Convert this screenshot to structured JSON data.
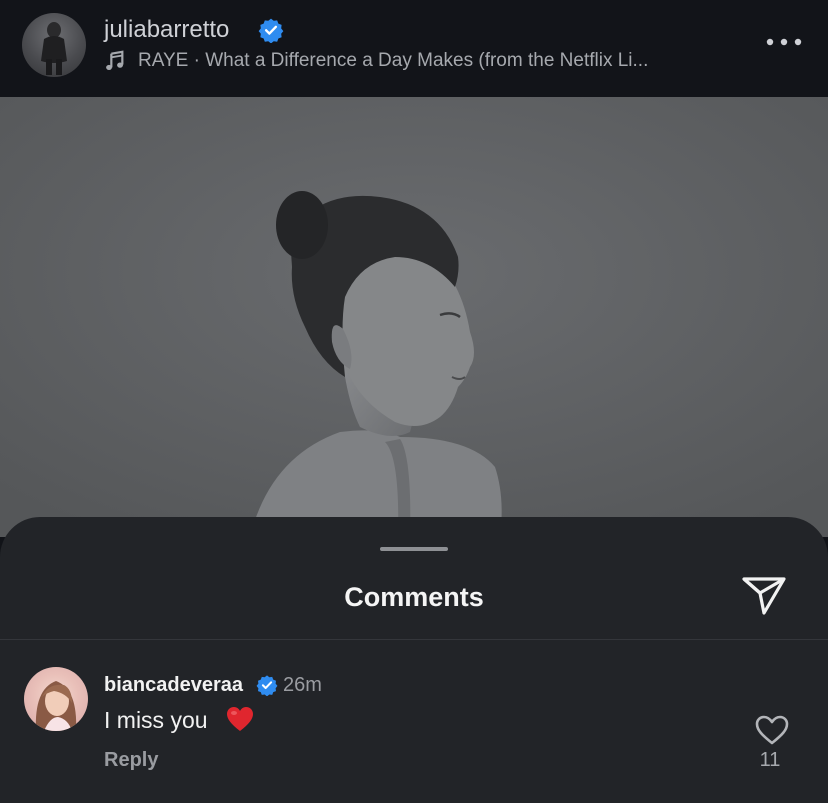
{
  "post": {
    "username": "juliabarretto",
    "verified": true,
    "song": "RAYE · What a Difference a Day Makes (from the Netflix Li..."
  },
  "icons": {
    "more": "more-horizontal-icon",
    "music": "music-note-icon",
    "verified": "verified-badge-icon",
    "send": "send-icon",
    "like": "heart-outline-icon"
  },
  "colors": {
    "verified_blue": "#2f8cf0",
    "sheet_bg": "#222428",
    "photo_bg": "#5b5d60"
  },
  "comments_sheet": {
    "title": "Comments",
    "comments": [
      {
        "username": "biancadeveraa",
        "verified": true,
        "time": "26m",
        "text": "I miss you",
        "emoji": "❤️",
        "reply_label": "Reply",
        "likes": "11"
      }
    ]
  }
}
